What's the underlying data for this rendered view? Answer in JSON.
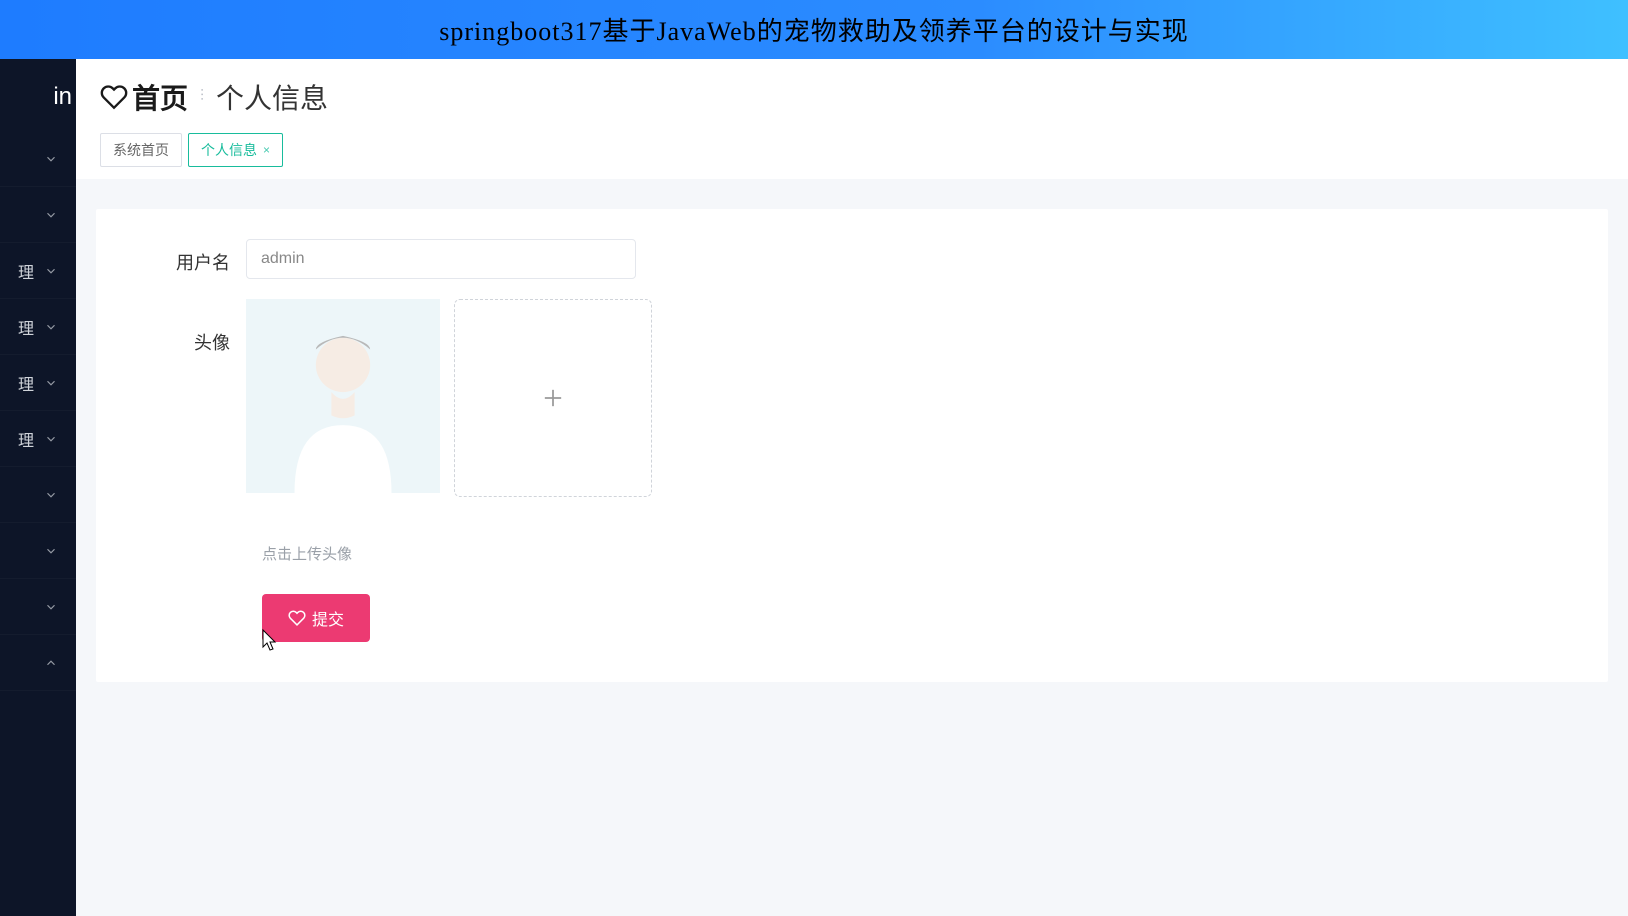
{
  "banner": {
    "title": "springboot317基于JavaWeb的宠物救助及领养平台的设计与实现"
  },
  "sidebar": {
    "brand_fragment": "in",
    "items": [
      {
        "label": "",
        "chevron": "down"
      },
      {
        "label": "",
        "chevron": "down"
      },
      {
        "label": "理",
        "chevron": "down"
      },
      {
        "label": "理",
        "chevron": "down"
      },
      {
        "label": "理",
        "chevron": "down"
      },
      {
        "label": "理",
        "chevron": "down"
      },
      {
        "label": "",
        "chevron": "down"
      },
      {
        "label": "",
        "chevron": "down"
      },
      {
        "label": "",
        "chevron": "down"
      },
      {
        "label": "",
        "chevron": "up"
      }
    ]
  },
  "breadcrumb": {
    "home": "首页",
    "current": "个人信息"
  },
  "tabs": [
    {
      "label": "系统首页",
      "closable": false,
      "active": false
    },
    {
      "label": "个人信息",
      "closable": true,
      "active": true
    }
  ],
  "form": {
    "username_label": "用户名",
    "username_value": "admin",
    "avatar_label": "头像",
    "upload_hint": "点击上传头像",
    "submit_label": "提交"
  }
}
